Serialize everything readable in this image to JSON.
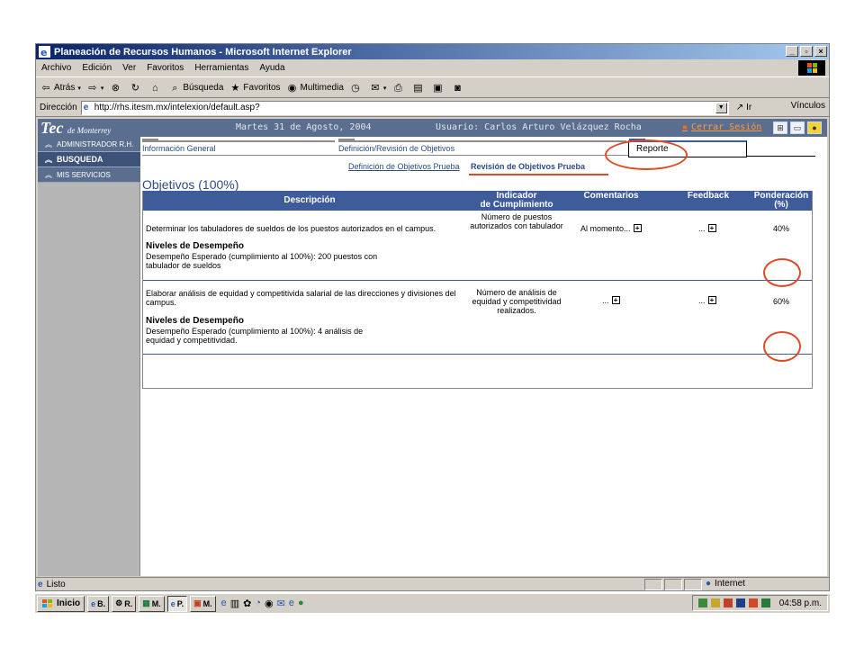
{
  "window": {
    "title": "Planeación de Recursos Humanos - Microsoft Internet Explorer",
    "buttons": [
      "_",
      "▫",
      "×"
    ]
  },
  "menu": [
    "Archivo",
    "Edición",
    "Ver",
    "Favoritos",
    "Herramientas",
    "Ayuda"
  ],
  "toolbar": {
    "back": "Atrás",
    "search": "Búsqueda",
    "favorites": "Favoritos",
    "multimedia": "Multimedia"
  },
  "address": {
    "label": "Dirección",
    "url": "http://rhs.itesm.mx/intelexion/default.asp?",
    "go": "Ir",
    "links": "Vínculos"
  },
  "header": {
    "logo": "Tec",
    "logo_sub": "de Monterrey",
    "date": "Martes 31 de Agosto, 2004",
    "user": "Usuario: Carlos Arturo Velázquez Rocha",
    "logout": "Cerrar Sesión"
  },
  "sidebar": {
    "items": [
      {
        "label": "ADMINISTRADOR R.H."
      },
      {
        "label": "BUSQUEDA"
      },
      {
        "label": "MIS SERVICIOS"
      }
    ]
  },
  "tabs": [
    "Información General",
    "Definición/Revisión de Objetivos",
    "Reporte"
  ],
  "subnav": [
    "Definición de Objetivos Prueba",
    "Revisión de Objetivos Prueba"
  ],
  "section_title": "Objetivos (100%)",
  "table": {
    "headers": {
      "descripcion": "Descripción",
      "indicador_1": "Indicador",
      "indicador_2": "de Cumplimiento",
      "comentarios": "Comentarios",
      "feedback": "Feedback",
      "ponderacion_1": "Ponderación",
      "ponderacion_2": "(%)"
    },
    "rows": [
      {
        "descripcion": "Determinar los tabuladores de sueldos de los puestos autorizados en el campus.",
        "niveles": "Niveles de Desempeño",
        "desempeno": "Desempeño Esperado (cumplimiento al 100%): 200 puestos con tabulador de sueldos",
        "indicador": "Número de puestos autorizados con tabulador",
        "comentarios": "Al momento...",
        "feedback": "...",
        "ponderacion": "40%"
      },
      {
        "descripcion": "Elaborar análisis de equidad y competitivida salarial de las direcciones y divisiones del campus.",
        "niveles": "Niveles de Desempeño",
        "desempeno": "Desempeño Esperado (cumplimiento al 100%): 4 análisis de equidad y competitividad.",
        "indicador": "Número de análisis de equidad y competitividad realizados.",
        "comentarios": "...",
        "feedback": "...",
        "ponderacion": "60%"
      }
    ]
  },
  "status": {
    "text": "Listo",
    "zone": "Internet"
  },
  "taskbar": {
    "start": "Inicio",
    "buttons": [
      "B.",
      "R.",
      "M.",
      "P.",
      "M."
    ],
    "clock": "04:58 p.m."
  },
  "colors": {
    "accent": "#3d5c99",
    "annotation": "#e04a22",
    "header": "#5a6f8f"
  }
}
